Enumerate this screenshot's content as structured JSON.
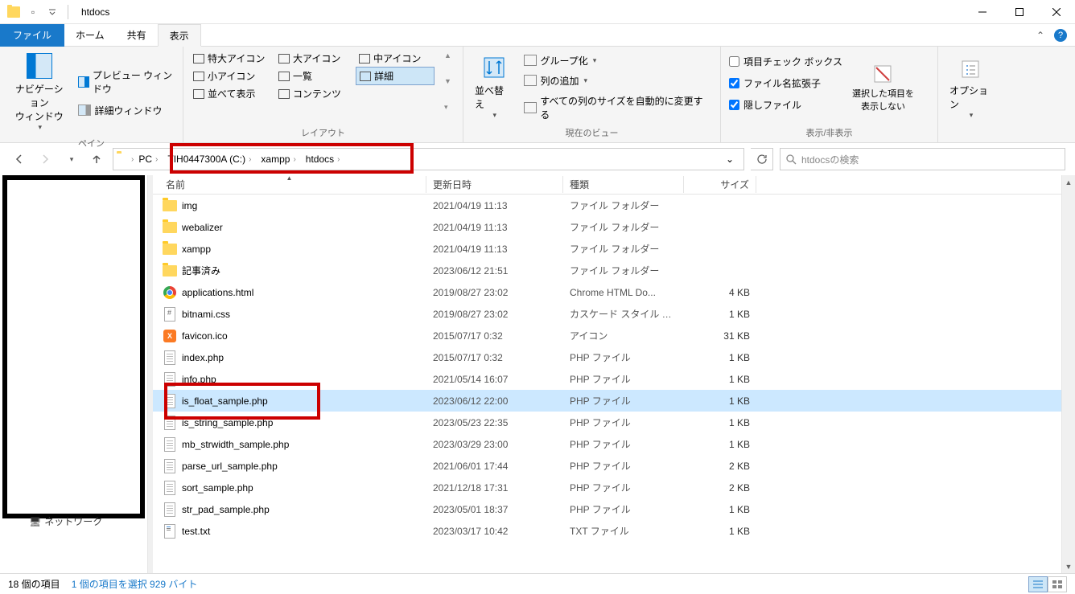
{
  "titlebar": {
    "title": "htdocs"
  },
  "ribbon": {
    "tabs": {
      "file": "ファイル",
      "home": "ホーム",
      "share": "共有",
      "view": "表示"
    },
    "panes": {
      "navigation": "ナビゲーション\nウィンドウ",
      "preview": "プレビュー ウィンドウ",
      "details": "詳細ウィンドウ",
      "group_label": "ペイン"
    },
    "layout": {
      "extra_large": "特大アイコン",
      "large": "大アイコン",
      "medium": "中アイコン",
      "small": "小アイコン",
      "list": "一覧",
      "details": "詳細",
      "tiles": "並べて表示",
      "content": "コンテンツ",
      "group_label": "レイアウト"
    },
    "current_view": {
      "sort": "並べ替え",
      "group_by": "グループ化",
      "add_columns": "列の追加",
      "size_all": "すべての列のサイズを自動的に変更する",
      "group_label": "現在のビュー"
    },
    "show_hide": {
      "check_boxes": "項目チェック ボックス",
      "extensions": "ファイル名拡張子",
      "hidden": "隠しファイル",
      "hide_selected": "選択した項目を\n表示しない",
      "group_label": "表示/非表示"
    },
    "options": "オプション"
  },
  "addressbar": {
    "crumbs": [
      "PC",
      "TIH0447300A (C:)",
      "xampp",
      "htdocs"
    ]
  },
  "search": {
    "placeholder": "htdocsの検索"
  },
  "columns": {
    "name": "名前",
    "date": "更新日時",
    "type": "種類",
    "size": "サイズ"
  },
  "files": [
    {
      "icon": "folder",
      "name": "img",
      "date": "2021/04/19 11:13",
      "type": "ファイル フォルダー",
      "size": ""
    },
    {
      "icon": "folder",
      "name": "webalizer",
      "date": "2021/04/19 11:13",
      "type": "ファイル フォルダー",
      "size": ""
    },
    {
      "icon": "folder",
      "name": "xampp",
      "date": "2021/04/19 11:13",
      "type": "ファイル フォルダー",
      "size": ""
    },
    {
      "icon": "folder",
      "name": "記事済み",
      "date": "2023/06/12 21:51",
      "type": "ファイル フォルダー",
      "size": ""
    },
    {
      "icon": "chrome",
      "name": "applications.html",
      "date": "2019/08/27 23:02",
      "type": "Chrome HTML Do...",
      "size": "4 KB"
    },
    {
      "icon": "css",
      "name": "bitnami.css",
      "date": "2019/08/27 23:02",
      "type": "カスケード スタイル シ...",
      "size": "1 KB"
    },
    {
      "icon": "xampp",
      "name": "favicon.ico",
      "date": "2015/07/17 0:32",
      "type": "アイコン",
      "size": "31 KB"
    },
    {
      "icon": "doc",
      "name": "index.php",
      "date": "2015/07/17 0:32",
      "type": "PHP ファイル",
      "size": "1 KB"
    },
    {
      "icon": "doc",
      "name": "info.php",
      "date": "2021/05/14 16:07",
      "type": "PHP ファイル",
      "size": "1 KB"
    },
    {
      "icon": "doc",
      "name": "is_float_sample.php",
      "date": "2023/06/12 22:00",
      "type": "PHP ファイル",
      "size": "1 KB",
      "selected": true
    },
    {
      "icon": "doc",
      "name": "is_string_sample.php",
      "date": "2023/05/23 22:35",
      "type": "PHP ファイル",
      "size": "1 KB"
    },
    {
      "icon": "doc",
      "name": "mb_strwidth_sample.php",
      "date": "2023/03/29 23:00",
      "type": "PHP ファイル",
      "size": "1 KB"
    },
    {
      "icon": "doc",
      "name": "parse_url_sample.php",
      "date": "2021/06/01 17:44",
      "type": "PHP ファイル",
      "size": "2 KB"
    },
    {
      "icon": "doc",
      "name": "sort_sample.php",
      "date": "2021/12/18 17:31",
      "type": "PHP ファイル",
      "size": "2 KB"
    },
    {
      "icon": "doc",
      "name": "str_pad_sample.php",
      "date": "2023/05/01 18:37",
      "type": "PHP ファイル",
      "size": "1 KB"
    },
    {
      "icon": "txt",
      "name": "test.txt",
      "date": "2023/03/17 10:42",
      "type": "TXT ファイル",
      "size": "1 KB"
    }
  ],
  "tree": {
    "network": "ネットワーク"
  },
  "statusbar": {
    "count": "18 個の項目",
    "selection": "1 個の項目を選択 929 バイト"
  }
}
